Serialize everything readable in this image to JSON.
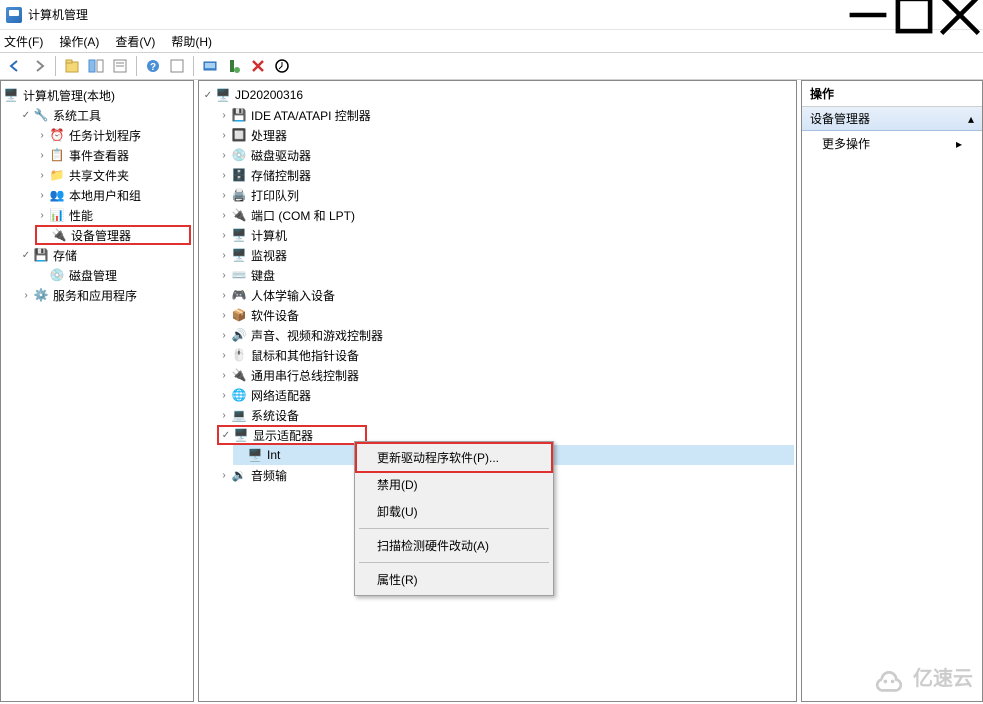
{
  "title": "计算机管理",
  "menu": {
    "file": "文件(F)",
    "action": "操作(A)",
    "view": "查看(V)",
    "help": "帮助(H)"
  },
  "left": {
    "root": "计算机管理(本地)",
    "systools": "系统工具",
    "tasksch": "任务计划程序",
    "eventv": "事件查看器",
    "shared": "共享文件夹",
    "localusers": "本地用户和组",
    "perf": "性能",
    "devmgr": "设备管理器",
    "storage": "存储",
    "diskmgmt": "磁盘管理",
    "services": "服务和应用程序"
  },
  "center": {
    "root": "JD20200316",
    "ide": "IDE ATA/ATAPI 控制器",
    "cpu": "处理器",
    "disk": "磁盘驱动器",
    "storage": "存储控制器",
    "printq": "打印队列",
    "ports": "端口 (COM 和 LPT)",
    "computer": "计算机",
    "monitor": "监视器",
    "keyboard": "键盘",
    "hid": "人体学输入设备",
    "sw": "软件设备",
    "sound": "声音、视频和游戏控制器",
    "mouse": "鼠标和其他指针设备",
    "usb": "通用串行总线控制器",
    "net": "网络适配器",
    "sysdev": "系统设备",
    "display": "显示适配器",
    "intel": "Int",
    "audio": "音频输"
  },
  "ctx": {
    "update": "更新驱动程序软件(P)...",
    "disable": "禁用(D)",
    "uninstall": "卸载(U)",
    "scan": "扫描检测硬件改动(A)",
    "prop": "属性(R)"
  },
  "right": {
    "head": "操作",
    "sub": "设备管理器",
    "more": "更多操作"
  },
  "watermark": "亿速云"
}
